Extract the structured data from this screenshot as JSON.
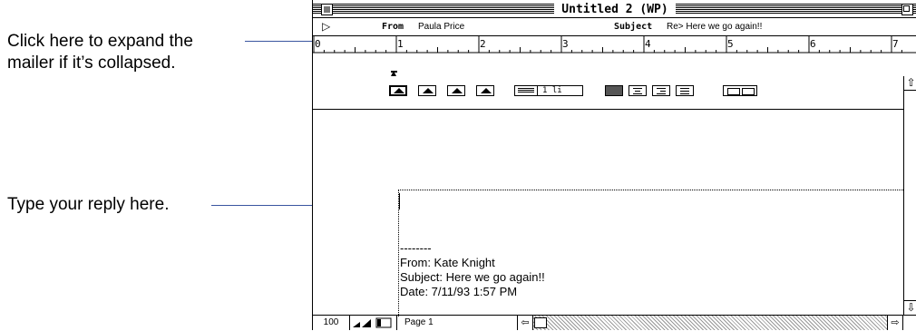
{
  "callouts": {
    "expand_line1": "Click here to expand the",
    "expand_line2": "mailer if it’s collapsed.",
    "reply": "Type your reply here."
  },
  "window": {
    "title": "Untitled 2 (WP)"
  },
  "mailer": {
    "expand_icon": "right-triangle-icon",
    "from_label": "From",
    "from_value": "Paula Price",
    "subject_label": "Subject",
    "subject_value": "Re> Here we go again!!"
  },
  "ruler": {
    "numbers": [
      "0",
      "1",
      "2",
      "3",
      "4",
      "5",
      "6",
      "7"
    ]
  },
  "toolbar": {
    "line_spacing": "1 li"
  },
  "document": {
    "quoted": {
      "separator": "--------",
      "from": "From: Kate Knight",
      "subject": "Subject: Here we go again!!",
      "date": "Date: 7/11/93 1:57 PM"
    }
  },
  "statusbar": {
    "zoom": "100",
    "page": "Page 1"
  }
}
